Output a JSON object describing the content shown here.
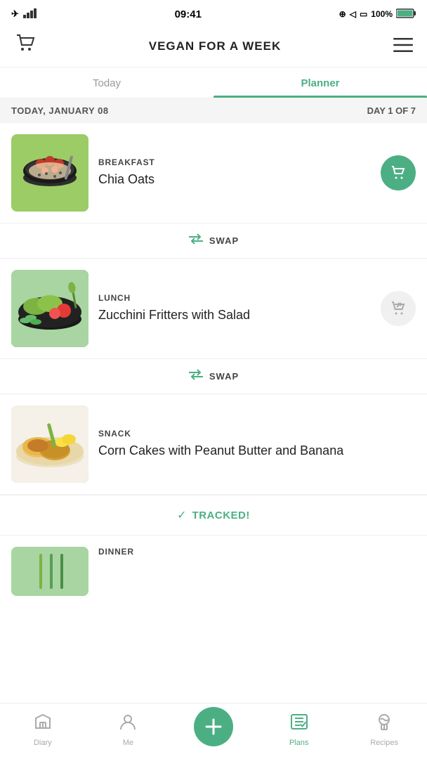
{
  "statusBar": {
    "time": "09:41",
    "battery": "100%",
    "signal": "●●●●"
  },
  "header": {
    "title": "VEGAN FOR A WEEK",
    "cartIcon": "🛒",
    "menuIcon": "≡"
  },
  "tabs": [
    {
      "id": "today",
      "label": "Today",
      "active": false
    },
    {
      "id": "planner",
      "label": "Planner",
      "active": true
    }
  ],
  "dateBar": {
    "date": "TODAY, JANUARY 08",
    "dayCount": "DAY 1 OF 7"
  },
  "meals": [
    {
      "id": "breakfast",
      "type": "BREAKFAST",
      "name": "Chia Oats",
      "cartActive": true
    },
    {
      "id": "lunch",
      "type": "LUNCH",
      "name": "Zucchini Fritters with Salad",
      "cartActive": false
    },
    {
      "id": "snack",
      "type": "SNACK",
      "name": "Corn Cakes with Peanut Butter and Banana",
      "cartActive": false,
      "tracked": true
    },
    {
      "id": "dinner",
      "type": "DINNER",
      "name": "",
      "cartActive": false
    }
  ],
  "swap": {
    "label": "SWAP",
    "icon": "⇄"
  },
  "tracked": {
    "label": "TRACKED!",
    "icon": "✓"
  },
  "bottomNav": [
    {
      "id": "diary",
      "label": "Diary",
      "icon": "🏠",
      "active": false
    },
    {
      "id": "me",
      "label": "Me",
      "icon": "👤",
      "active": false
    },
    {
      "id": "add",
      "label": "",
      "icon": "+",
      "active": false
    },
    {
      "id": "plans",
      "label": "Plans",
      "icon": "📋",
      "active": true
    },
    {
      "id": "recipes",
      "label": "Recipes",
      "icon": "👨‍🍳",
      "active": false
    }
  ]
}
